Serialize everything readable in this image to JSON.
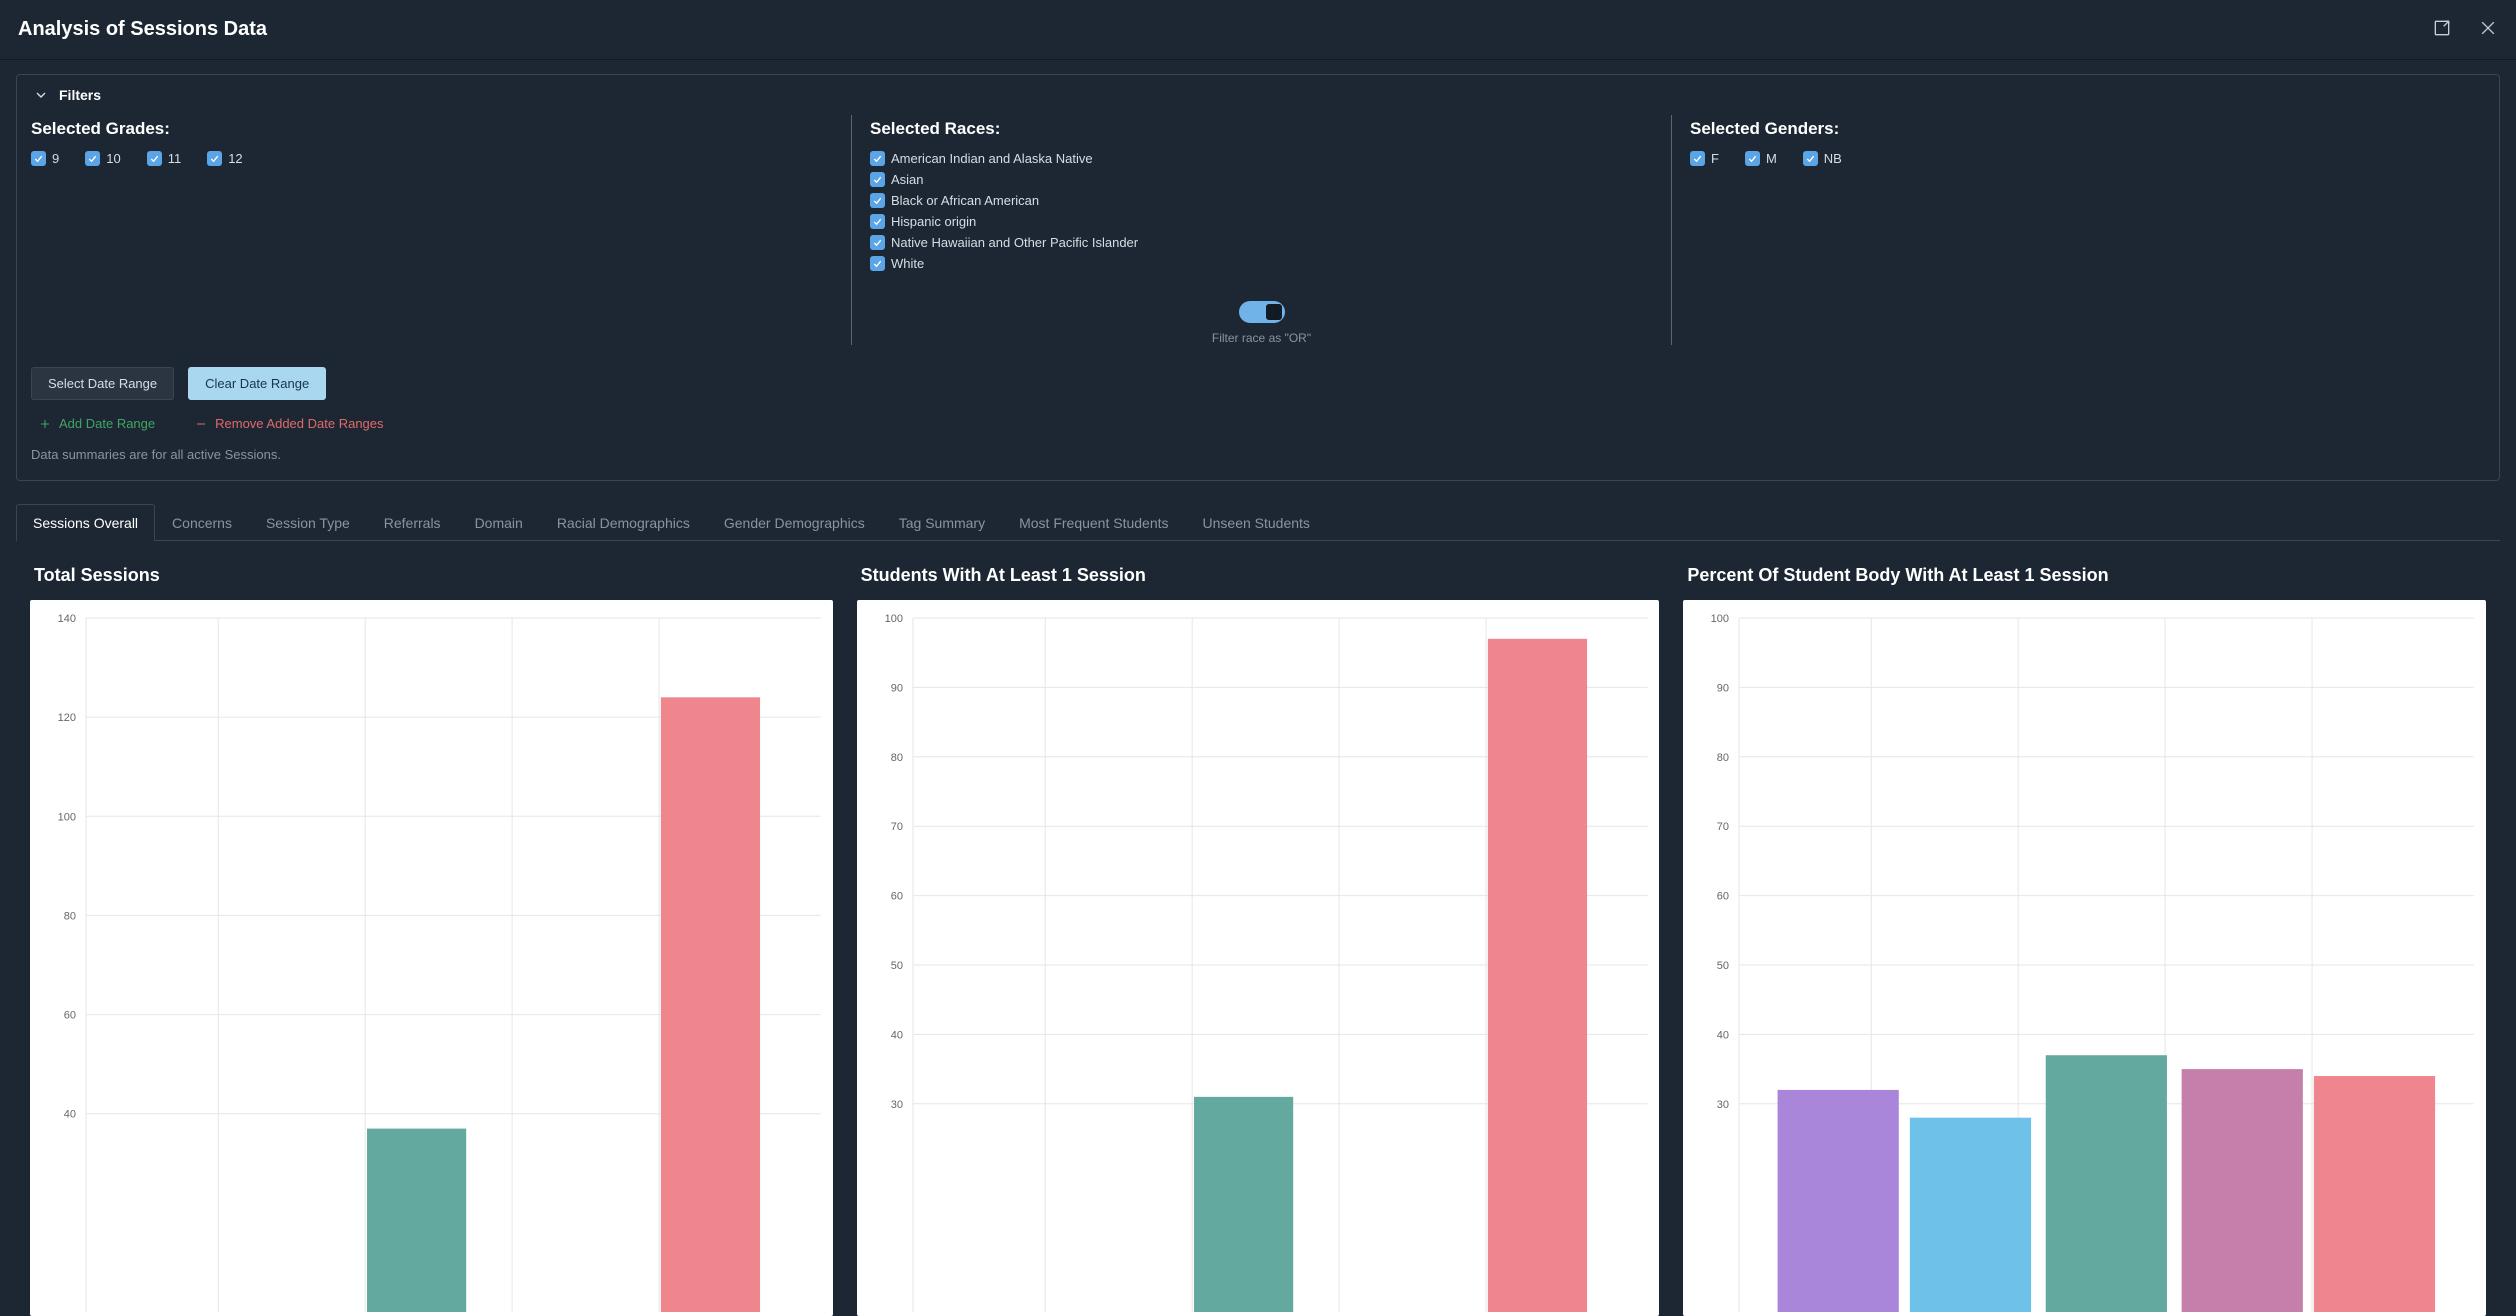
{
  "title": "Analysis of Sessions Data",
  "filters": {
    "header": "Filters",
    "grades_title": "Selected Grades:",
    "grades": [
      "9",
      "10",
      "11",
      "12"
    ],
    "races_title": "Selected Races:",
    "races": [
      "American Indian and Alaska Native",
      "Asian",
      "Black or African American",
      "Hispanic origin",
      "Native Hawaiian and Other Pacific Islander",
      "White"
    ],
    "race_toggle_label": "Filter race as \"OR\"",
    "genders_title": "Selected Genders:",
    "genders": [
      "F",
      "M",
      "NB"
    ],
    "select_date_btn": "Select Date Range",
    "clear_date_btn": "Clear Date Range",
    "add_date_link": "Add Date Range",
    "remove_date_link": "Remove Added Date Ranges",
    "note": "Data summaries are for all active Sessions."
  },
  "tabs": [
    "Sessions Overall",
    "Concerns",
    "Session Type",
    "Referrals",
    "Domain",
    "Racial Demographics",
    "Gender Demographics",
    "Tag Summary",
    "Most Frequent Students",
    "Unseen Students"
  ],
  "active_tab": 0,
  "chart_titles": {
    "total": "Total Sessions",
    "students": "Students With At Least 1 Session",
    "percent": "Percent Of Student Body With At Least 1 Session"
  },
  "chart_data": [
    {
      "id": "total",
      "type": "bar",
      "ylim": [
        0,
        140
      ],
      "ytick_step": 20,
      "ytick_min": 40,
      "bars": [
        {
          "x_frac": 0.45,
          "value": 37,
          "color": "#64a9a0"
        },
        {
          "x_frac": 0.85,
          "value": 124,
          "color": "#f0868d"
        }
      ],
      "bar_w_frac": 0.135
    },
    {
      "id": "students",
      "type": "bar",
      "ylim": [
        0,
        100
      ],
      "ytick_step": 10,
      "ytick_min": 30,
      "bars": [
        {
          "x_frac": 0.45,
          "value": 31,
          "color": "#64a9a0"
        },
        {
          "x_frac": 0.85,
          "value": 97,
          "color": "#f0868d"
        }
      ],
      "bar_w_frac": 0.135
    },
    {
      "id": "percent",
      "type": "bar",
      "ylim": [
        0,
        100
      ],
      "ytick_step": 10,
      "ytick_min": 30,
      "bars": [
        {
          "x_frac": 0.135,
          "value": 32,
          "color": "#a986d9"
        },
        {
          "x_frac": 0.315,
          "value": 28,
          "color": "#6ec2ea"
        },
        {
          "x_frac": 0.5,
          "value": 37,
          "color": "#64a9a0"
        },
        {
          "x_frac": 0.685,
          "value": 35,
          "color": "#c57faa"
        },
        {
          "x_frac": 0.865,
          "value": 34,
          "color": "#f0868d"
        }
      ],
      "bar_w_frac": 0.165
    }
  ]
}
